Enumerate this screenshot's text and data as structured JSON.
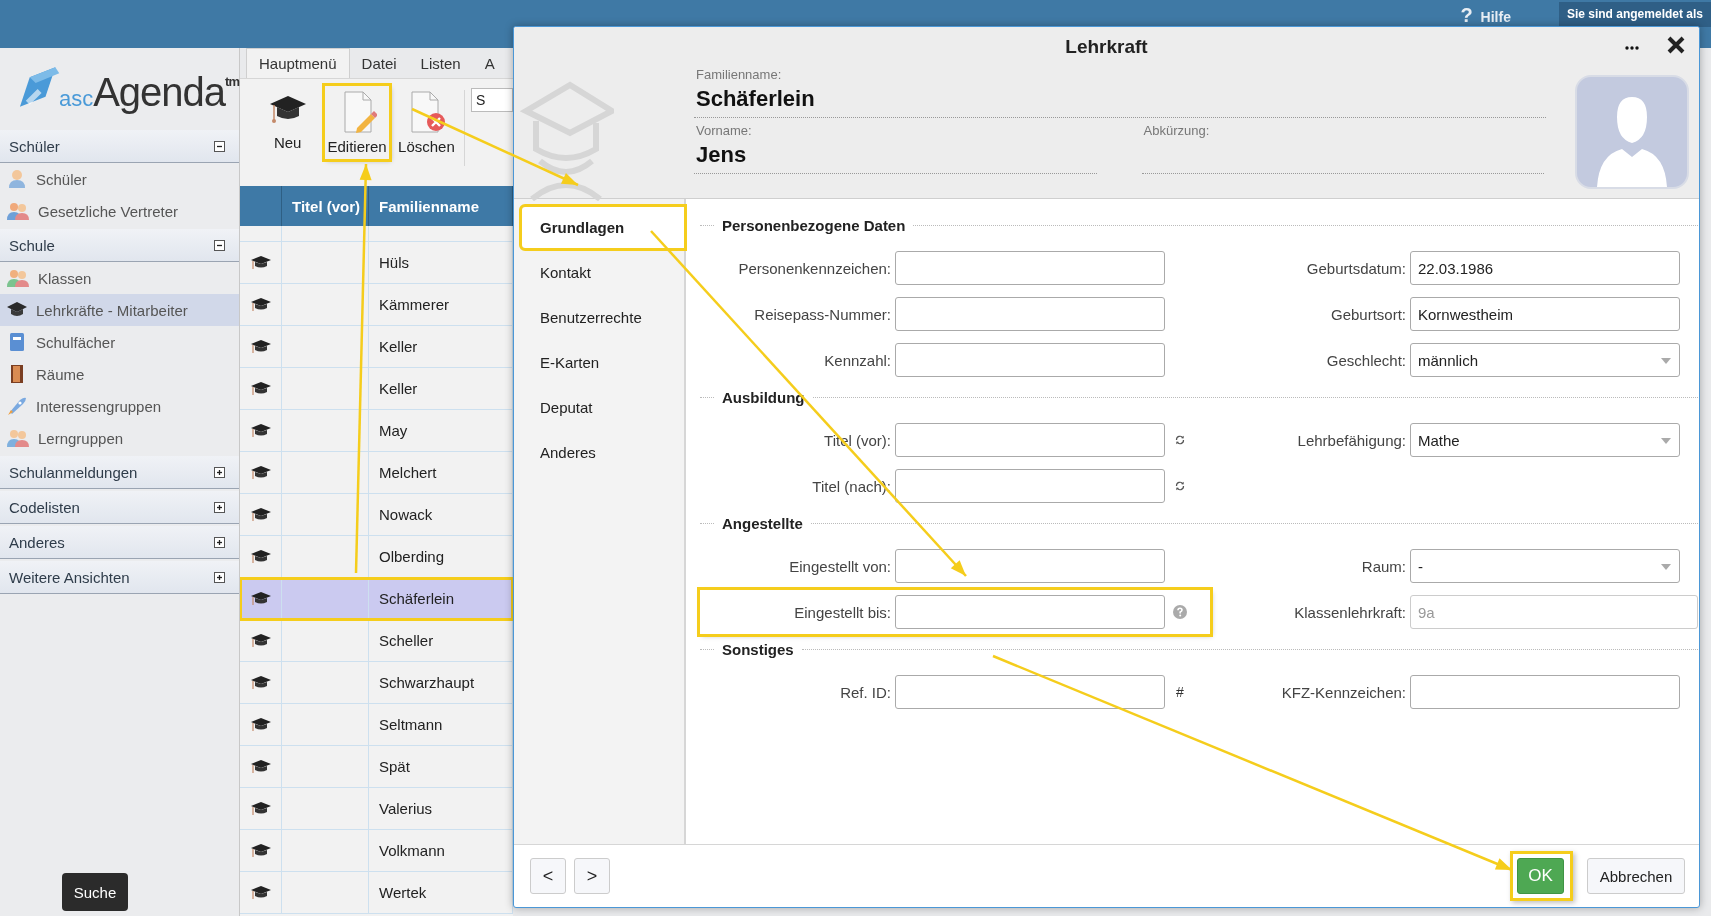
{
  "top_bar": {
    "help_glyph": "?",
    "help": "Hilfe",
    "login_status": "Sie sind angemeldet als"
  },
  "logo": {
    "prefix": "asc",
    "name": "Agenda",
    "mark": "tm"
  },
  "sidebar": {
    "sections": [
      {
        "title": "Schüler",
        "expanded": true,
        "items": [
          {
            "label": "Schüler",
            "kind": "student",
            "selected": false
          },
          {
            "label": "Gesetzliche Vertreter",
            "kind": "guardians",
            "selected": false
          }
        ]
      },
      {
        "title": "Schule",
        "expanded": true,
        "items": [
          {
            "label": "Klassen",
            "kind": "classes",
            "selected": false
          },
          {
            "label": "Lehrkräfte - Mitarbeiter",
            "kind": "teacher",
            "selected": true
          },
          {
            "label": "Schulfächer",
            "kind": "subject",
            "selected": false
          },
          {
            "label": "Räume",
            "kind": "room",
            "selected": false
          },
          {
            "label": "Interessengruppen",
            "kind": "rocket",
            "selected": false
          },
          {
            "label": "Lerngruppen",
            "kind": "groups",
            "selected": false
          }
        ]
      },
      {
        "title": "Schulanmeldungen",
        "expanded": false
      },
      {
        "title": "Codelisten",
        "expanded": false
      },
      {
        "title": "Anderes",
        "expanded": false
      },
      {
        "title": "Weitere Ansichten",
        "expanded": false
      }
    ],
    "search_button": "Suche"
  },
  "ribbon": {
    "tabs": [
      {
        "label": "Hauptmenü",
        "selected": true
      },
      {
        "label": "Datei",
        "selected": false
      },
      {
        "label": "Listen",
        "selected": false
      },
      {
        "label": "A",
        "selected": false
      }
    ],
    "buttons": [
      {
        "label": "Neu",
        "kind": "new",
        "highlighted": false
      },
      {
        "label": "Editieren",
        "kind": "edit",
        "highlighted": true
      },
      {
        "label": "Löschen",
        "kind": "delete",
        "highlighted": false
      }
    ],
    "search": {
      "value": "S"
    }
  },
  "table": {
    "columns": [
      "Titel (vor)",
      "Familienname"
    ],
    "rows": [
      {
        "name": "Hüls",
        "selected": false,
        "highlighted": false
      },
      {
        "name": "Kämmerer",
        "selected": false,
        "highlighted": false
      },
      {
        "name": "Keller",
        "selected": false,
        "highlighted": false
      },
      {
        "name": "Keller",
        "selected": false,
        "highlighted": false
      },
      {
        "name": "May",
        "selected": false,
        "highlighted": false
      },
      {
        "name": "Melchert",
        "selected": false,
        "highlighted": false
      },
      {
        "name": "Nowack",
        "selected": false,
        "highlighted": false
      },
      {
        "name": "Olberding",
        "selected": false,
        "highlighted": false
      },
      {
        "name": "Schäferlein",
        "selected": true,
        "highlighted": true
      },
      {
        "name": "Scheller",
        "selected": false,
        "highlighted": false
      },
      {
        "name": "Schwarzhaupt",
        "selected": false,
        "highlighted": false
      },
      {
        "name": "Seltmann",
        "selected": false,
        "highlighted": false
      },
      {
        "name": "Spät",
        "selected": false,
        "highlighted": false
      },
      {
        "name": "Valerius",
        "selected": false,
        "highlighted": false
      },
      {
        "name": "Volkmann",
        "selected": false,
        "highlighted": false
      },
      {
        "name": "Wertek",
        "selected": false,
        "highlighted": false
      }
    ]
  },
  "dialog": {
    "title": "Lehrkraft",
    "header_fields": [
      {
        "label": "Familienname:",
        "value": "Schäferlein"
      },
      {
        "label": "Vorname:",
        "value": "Jens"
      },
      {
        "label": "Abkürzung:"
      }
    ],
    "nav": [
      {
        "label": "Grundlagen",
        "selected": true,
        "highlighted": true
      },
      {
        "label": "Kontakt",
        "selected": false,
        "highlighted": false
      },
      {
        "label": "Benutzerrechte",
        "selected": false,
        "highlighted": false
      },
      {
        "label": "E-Karten",
        "selected": false,
        "highlighted": false
      },
      {
        "label": "Deputat",
        "selected": false,
        "highlighted": false
      },
      {
        "label": "Anderes",
        "selected": false,
        "highlighted": false
      }
    ],
    "sections": [
      {
        "title": "Personenbezogene Daten",
        "rows": [
          {
            "left": {
              "label": "Personenkennzeichen:",
              "kind": "text",
              "highlighted": false
            },
            "right": {
              "label": "Geburtsdatum:",
              "kind": "text",
              "value": "22.03.1986",
              "highlighted": false
            }
          },
          {
            "left": {
              "label": "Reisepass-Nummer:",
              "kind": "text",
              "highlighted": false
            },
            "right": {
              "label": "Geburtsort:",
              "kind": "text",
              "value": "Kornwestheim",
              "highlighted": false
            }
          },
          {
            "left": {
              "label": "Kennzahl:",
              "kind": "text",
              "highlighted": false
            },
            "right": {
              "label": "Geschlecht:",
              "kind": "select",
              "value": "männlich",
              "highlighted": false
            }
          }
        ]
      },
      {
        "title": "Ausbildung",
        "rows": [
          {
            "left": {
              "label": "Titel (vor):",
              "kind": "resettable",
              "highlighted": false
            },
            "right": {
              "label": "Lehrbefähigung:",
              "kind": "select",
              "value": "Mathe",
              "highlighted": false
            }
          },
          {
            "left": {
              "label": "Titel (nach):",
              "kind": "resettable",
              "highlighted": false
            }
          }
        ]
      },
      {
        "title": "Angestellte",
        "rows": [
          {
            "left": {
              "label": "Eingestellt von:",
              "kind": "text",
              "highlighted": false
            },
            "right": {
              "label": "Raum:",
              "kind": "select",
              "value": "-",
              "highlighted": false
            }
          },
          {
            "left": {
              "label": "Eingestellt bis:",
              "kind": "hinted",
              "highlighted": true
            },
            "right": {
              "label": "Klassenlehrkraft:",
              "kind": "readonly",
              "value": "9a",
              "highlighted": false
            }
          }
        ]
      },
      {
        "title": "Sonstiges",
        "rows": [
          {
            "left": {
              "label": "Ref. ID:",
              "kind": "text",
              "suffix": "#",
              "highlighted": false
            },
            "right": {
              "label": "KFZ-Kennzeichen:",
              "kind": "text",
              "highlighted": false
            }
          }
        ]
      }
    ],
    "footer": {
      "prev": "<",
      "next": ">",
      "ok": {
        "label": "OK",
        "highlighted": true
      },
      "cancel": "Abbrechen"
    }
  }
}
